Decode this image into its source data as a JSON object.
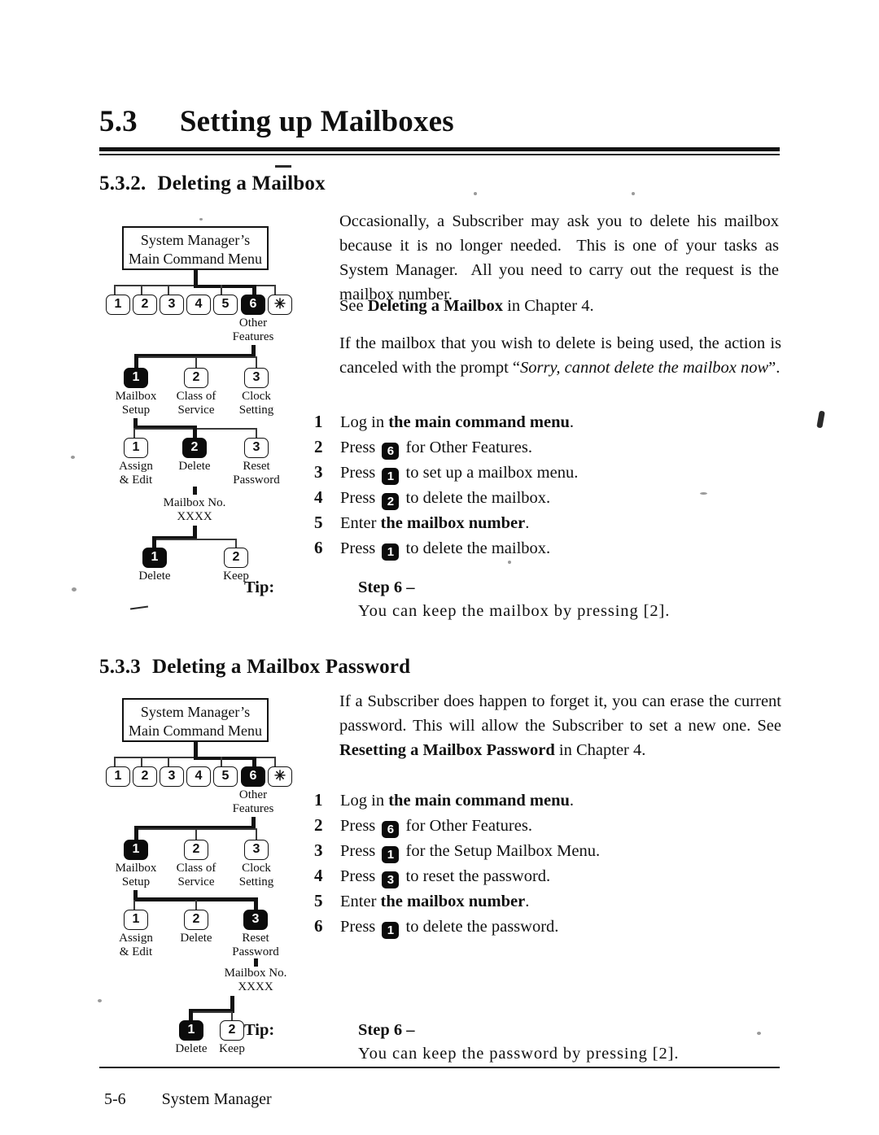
{
  "page": {
    "chapter_number": "5.3",
    "chapter_title": "Setting up Mailboxes",
    "footer_page": "5-6",
    "footer_text": "System Manager"
  },
  "sections": [
    {
      "number": "5.3.2.",
      "title": "Deleting a Mailbox",
      "paragraphs": [
        "Occasionally, a Subscriber may ask you to delete his mailbox because it is no longer needed. This is one of your tasks as System Manager. All you need to carry out the request is the mailbox number.",
        "See Deleting a Mailbox in Chapter 4.",
        "If the mailbox that you wish to delete is being used, the action is canceled with the prompt “Sorry, cannot delete the mailbox now”."
      ],
      "para_see_prefix": "See ",
      "para_see_bold": "Deleting a Mailbox",
      "para_see_suffix": " in Chapter 4.",
      "steps": [
        {
          "n": "1",
          "pre": "Log in ",
          "bold": "the main command menu",
          "key": "",
          "post": "."
        },
        {
          "n": "2",
          "pre": "Press ",
          "bold": "",
          "key": "6",
          "post": " for Other Features."
        },
        {
          "n": "3",
          "pre": "Press ",
          "bold": "",
          "key": "1",
          "post": " to set up a mailbox menu."
        },
        {
          "n": "4",
          "pre": "Press ",
          "bold": "",
          "key": "2",
          "post": " to delete the mailbox."
        },
        {
          "n": "5",
          "pre": "Enter ",
          "bold": "the mailbox number",
          "key": "",
          "post": "."
        },
        {
          "n": "6",
          "pre": "Press ",
          "bold": "",
          "key": "1",
          "post": " to delete the mailbox."
        }
      ],
      "tip": {
        "label": "Tip:",
        "step": "Step 6 –",
        "body": "You can keep the mailbox by pressing [2]."
      },
      "diagram": {
        "root_line1": "System Manager’s",
        "root_line2": "Main Command Menu",
        "keyrow": [
          {
            "label": "1",
            "on": false
          },
          {
            "label": "2",
            "on": false
          },
          {
            "label": "3",
            "on": false
          },
          {
            "label": "4",
            "on": false
          },
          {
            "label": "5",
            "on": false
          },
          {
            "label": "6",
            "on": true
          },
          {
            "label": "✳",
            "on": false
          }
        ],
        "keyrow_caption_line1": "Other",
        "keyrow_caption_line2": "Features",
        "level2": [
          {
            "key": "1",
            "on": true,
            "l1": "Mailbox",
            "l2": "Setup"
          },
          {
            "key": "2",
            "on": false,
            "l1": "Class of",
            "l2": "Service"
          },
          {
            "key": "3",
            "on": false,
            "l1": "Clock",
            "l2": "Setting"
          }
        ],
        "level3": [
          {
            "key": "1",
            "on": false,
            "l1": "Assign",
            "l2": "& Edit"
          },
          {
            "key": "2",
            "on": true,
            "l1": "Delete",
            "l2": ""
          },
          {
            "key": "3",
            "on": false,
            "l1": "Reset",
            "l2": "Password"
          }
        ],
        "mailbox_no_line1": "Mailbox No.",
        "mailbox_no_line2": "XXXX",
        "level4": [
          {
            "key": "1",
            "on": true,
            "l1": "Delete",
            "l2": ""
          },
          {
            "key": "2",
            "on": false,
            "l1": "Keep",
            "l2": ""
          }
        ]
      }
    },
    {
      "number": "5.3.3",
      "title": "Deleting a Mailbox Password",
      "paragraphs": [
        "If a Subscriber does happen to forget it, you can erase the current password. This will allow the Subscriber to set a new one. See Resetting a Mailbox Password in Chapter 4."
      ],
      "para_pre": "If a Subscriber does happen to forget it, you can erase the current password.  This will allow the Subscriber to set a new one.  See ",
      "para_bold": "Resetting a Mailbox Password",
      "para_post": " in Chapter 4.",
      "steps": [
        {
          "n": "1",
          "pre": "Log in ",
          "bold": "the main command menu",
          "key": "",
          "post": "."
        },
        {
          "n": "2",
          "pre": "Press ",
          "bold": "",
          "key": "6",
          "post": " for Other Features."
        },
        {
          "n": "3",
          "pre": "Press ",
          "bold": "",
          "key": "1",
          "post": " for the Setup Mailbox Menu."
        },
        {
          "n": "4",
          "pre": "Press ",
          "bold": "",
          "key": "3",
          "post": " to reset the password."
        },
        {
          "n": "5",
          "pre": "Enter ",
          "bold": "the mailbox number",
          "key": "",
          "post": "."
        },
        {
          "n": "6",
          "pre": "Press ",
          "bold": "",
          "key": "1",
          "post": " to delete the password."
        }
      ],
      "tip": {
        "label": "Tip:",
        "step": "Step 6 –",
        "body": "You can keep the password by pressing [2]."
      },
      "diagram": {
        "root_line1": "System Manager’s",
        "root_line2": "Main Command Menu",
        "keyrow": [
          {
            "label": "1",
            "on": false
          },
          {
            "label": "2",
            "on": false
          },
          {
            "label": "3",
            "on": false
          },
          {
            "label": "4",
            "on": false
          },
          {
            "label": "5",
            "on": false
          },
          {
            "label": "6",
            "on": true
          },
          {
            "label": "✳",
            "on": false
          }
        ],
        "keyrow_caption_line1": "Other",
        "keyrow_caption_line2": "Features",
        "level2": [
          {
            "key": "1",
            "on": true,
            "l1": "Mailbox",
            "l2": "Setup"
          },
          {
            "key": "2",
            "on": false,
            "l1": "Class of",
            "l2": "Service"
          },
          {
            "key": "3",
            "on": false,
            "l1": "Clock",
            "l2": "Setting"
          }
        ],
        "level3": [
          {
            "key": "1",
            "on": false,
            "l1": "Assign",
            "l2": "& Edit"
          },
          {
            "key": "2",
            "on": false,
            "l1": "Delete",
            "l2": ""
          },
          {
            "key": "3",
            "on": true,
            "l1": "Reset",
            "l2": "Password"
          }
        ],
        "mailbox_no_line1": "Mailbox No.",
        "mailbox_no_line2": "XXXX",
        "level4": [
          {
            "key": "1",
            "on": true,
            "l1": "Delete",
            "l2": ""
          },
          {
            "key": "2",
            "on": false,
            "l1": "Keep",
            "l2": ""
          }
        ]
      }
    }
  ]
}
